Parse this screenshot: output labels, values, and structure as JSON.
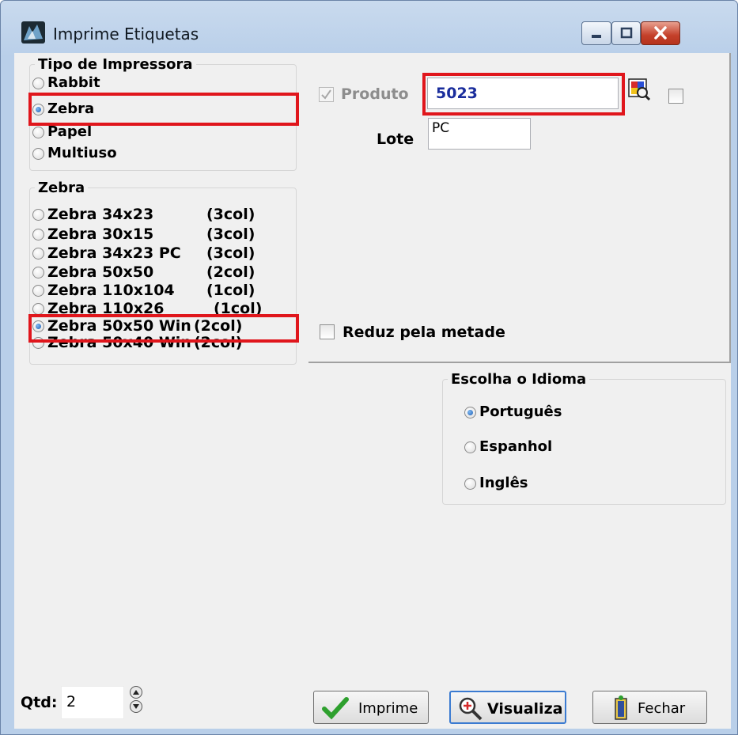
{
  "window": {
    "title": "Imprime Etiquetas"
  },
  "printer_type": {
    "title": "Tipo de Impressora",
    "options": [
      "Rabbit",
      "Zebra",
      "Papel",
      "Multiuso"
    ],
    "selected": "Zebra"
  },
  "zebra": {
    "title": "Zebra",
    "options": [
      {
        "name": "Zebra 34x23",
        "cols": "(3col)"
      },
      {
        "name": "Zebra 30x15",
        "cols": "(3col)"
      },
      {
        "name": "Zebra 34x23 PC",
        "cols": "(3col)"
      },
      {
        "name": "Zebra 50x50",
        "cols": "(2col)"
      },
      {
        "name": "Zebra 110x104",
        "cols": "(1col)"
      },
      {
        "name": "Zebra 110x26",
        "cols": "(1col)"
      },
      {
        "name": "Zebra 50x50 Win",
        "cols": "(2col)"
      },
      {
        "name": "Zebra 50x40 Win",
        "cols": "(2col)"
      }
    ],
    "selected": "Zebra 50x50 Win"
  },
  "product": {
    "label": "Produto",
    "value": "5023",
    "checked": true,
    "disabled": true
  },
  "lot": {
    "label": "Lote",
    "value": "PC"
  },
  "halve": {
    "label": "Reduz pela metade",
    "checked": false
  },
  "language": {
    "title": "Escolha o Idioma",
    "options": [
      "Português",
      "Espanhol",
      "Inglês"
    ],
    "selected": "Português"
  },
  "quantity": {
    "label": "Qtd:",
    "value": "2"
  },
  "buttons": {
    "print": "Imprime",
    "preview": "Visualiza",
    "close": "Fechar"
  },
  "colors": {
    "highlight": "#e0161c",
    "client_bg": "#f0f0f0",
    "product_text": "#1a2d9c"
  }
}
